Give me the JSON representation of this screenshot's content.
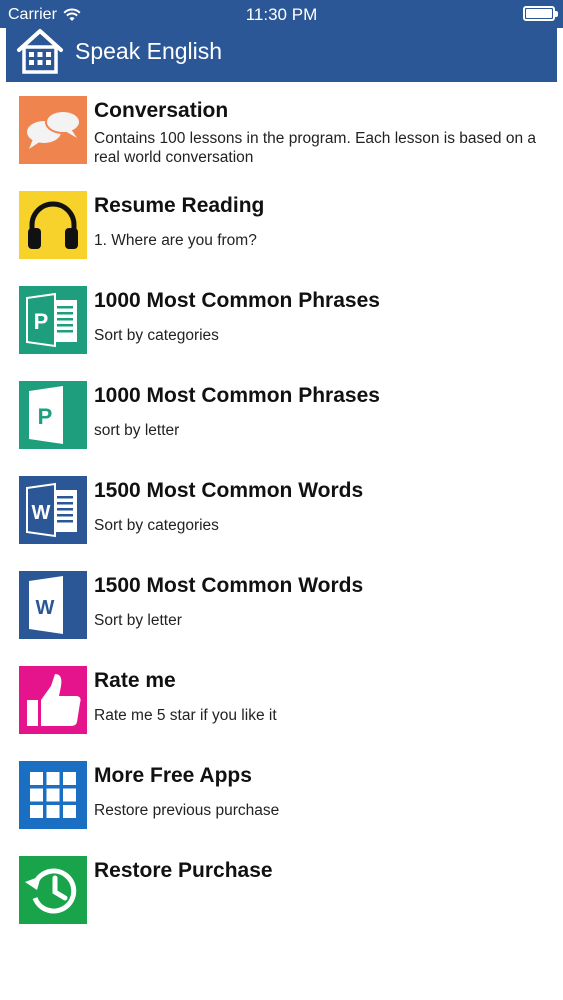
{
  "status_bar": {
    "carrier": "Carrier",
    "time": "11:30 PM",
    "wifi_icon": "wifi-icon",
    "battery_icon": "battery-icon"
  },
  "nav": {
    "title": "Speak English",
    "home_icon": "home-icon"
  },
  "colors": {
    "nav": "#2b5797",
    "conversation": "#f0844f",
    "resume": "#f7d22a",
    "publisher": "#1e9e7c",
    "word": "#2b5797",
    "rate": "#e5138c",
    "apps": "#1b6fc2",
    "restore": "#19a34a"
  },
  "items": [
    {
      "title": "Conversation",
      "subtitle": "Contains 100 lessons in the program. Each lesson is based on a real world conversation",
      "icon": "chat-bubbles-icon"
    },
    {
      "title": "Resume Reading",
      "subtitle": "1. Where are you from?",
      "icon": "headphones-icon"
    },
    {
      "title": "1000 Most Common Phrases",
      "subtitle": "Sort by categories",
      "icon": "publisher-document-icon"
    },
    {
      "title": "1000 Most Common Phrases",
      "subtitle": "sort by letter",
      "icon": "publisher-icon"
    },
    {
      "title": "1500 Most Common Words",
      "subtitle": "Sort by categories",
      "icon": "word-document-icon"
    },
    {
      "title": "1500 Most Common Words",
      "subtitle": "Sort by letter",
      "icon": "word-icon"
    },
    {
      "title": "Rate me",
      "subtitle": "Rate me 5 star if you like it",
      "icon": "thumbs-up-icon"
    },
    {
      "title": "More Free Apps",
      "subtitle": "Restore previous purchase",
      "icon": "app-grid-icon"
    },
    {
      "title": "Restore Purchase",
      "subtitle": "",
      "icon": "history-clock-icon"
    }
  ]
}
